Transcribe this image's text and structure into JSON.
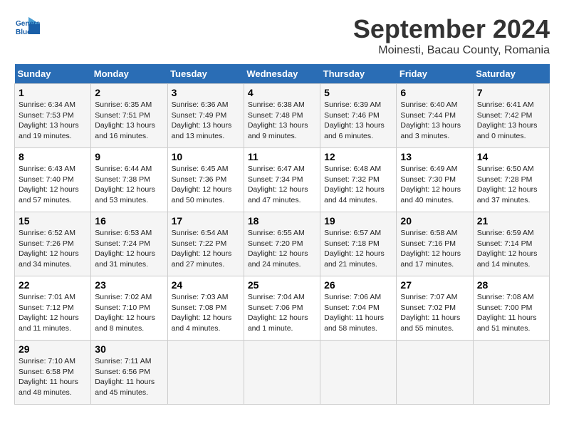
{
  "header": {
    "logo_line1": "General",
    "logo_line2": "Blue",
    "title": "September 2024",
    "subtitle": "Moinesti, Bacau County, Romania"
  },
  "days_of_week": [
    "Sunday",
    "Monday",
    "Tuesday",
    "Wednesday",
    "Thursday",
    "Friday",
    "Saturday"
  ],
  "weeks": [
    [
      {
        "day": "1",
        "sunrise": "Sunrise: 6:34 AM",
        "sunset": "Sunset: 7:53 PM",
        "daylight": "Daylight: 13 hours and 19 minutes."
      },
      {
        "day": "2",
        "sunrise": "Sunrise: 6:35 AM",
        "sunset": "Sunset: 7:51 PM",
        "daylight": "Daylight: 13 hours and 16 minutes."
      },
      {
        "day": "3",
        "sunrise": "Sunrise: 6:36 AM",
        "sunset": "Sunset: 7:49 PM",
        "daylight": "Daylight: 13 hours and 13 minutes."
      },
      {
        "day": "4",
        "sunrise": "Sunrise: 6:38 AM",
        "sunset": "Sunset: 7:48 PM",
        "daylight": "Daylight: 13 hours and 9 minutes."
      },
      {
        "day": "5",
        "sunrise": "Sunrise: 6:39 AM",
        "sunset": "Sunset: 7:46 PM",
        "daylight": "Daylight: 13 hours and 6 minutes."
      },
      {
        "day": "6",
        "sunrise": "Sunrise: 6:40 AM",
        "sunset": "Sunset: 7:44 PM",
        "daylight": "Daylight: 13 hours and 3 minutes."
      },
      {
        "day": "7",
        "sunrise": "Sunrise: 6:41 AM",
        "sunset": "Sunset: 7:42 PM",
        "daylight": "Daylight: 13 hours and 0 minutes."
      }
    ],
    [
      {
        "day": "8",
        "sunrise": "Sunrise: 6:43 AM",
        "sunset": "Sunset: 7:40 PM",
        "daylight": "Daylight: 12 hours and 57 minutes."
      },
      {
        "day": "9",
        "sunrise": "Sunrise: 6:44 AM",
        "sunset": "Sunset: 7:38 PM",
        "daylight": "Daylight: 12 hours and 53 minutes."
      },
      {
        "day": "10",
        "sunrise": "Sunrise: 6:45 AM",
        "sunset": "Sunset: 7:36 PM",
        "daylight": "Daylight: 12 hours and 50 minutes."
      },
      {
        "day": "11",
        "sunrise": "Sunrise: 6:47 AM",
        "sunset": "Sunset: 7:34 PM",
        "daylight": "Daylight: 12 hours and 47 minutes."
      },
      {
        "day": "12",
        "sunrise": "Sunrise: 6:48 AM",
        "sunset": "Sunset: 7:32 PM",
        "daylight": "Daylight: 12 hours and 44 minutes."
      },
      {
        "day": "13",
        "sunrise": "Sunrise: 6:49 AM",
        "sunset": "Sunset: 7:30 PM",
        "daylight": "Daylight: 12 hours and 40 minutes."
      },
      {
        "day": "14",
        "sunrise": "Sunrise: 6:50 AM",
        "sunset": "Sunset: 7:28 PM",
        "daylight": "Daylight: 12 hours and 37 minutes."
      }
    ],
    [
      {
        "day": "15",
        "sunrise": "Sunrise: 6:52 AM",
        "sunset": "Sunset: 7:26 PM",
        "daylight": "Daylight: 12 hours and 34 minutes."
      },
      {
        "day": "16",
        "sunrise": "Sunrise: 6:53 AM",
        "sunset": "Sunset: 7:24 PM",
        "daylight": "Daylight: 12 hours and 31 minutes."
      },
      {
        "day": "17",
        "sunrise": "Sunrise: 6:54 AM",
        "sunset": "Sunset: 7:22 PM",
        "daylight": "Daylight: 12 hours and 27 minutes."
      },
      {
        "day": "18",
        "sunrise": "Sunrise: 6:55 AM",
        "sunset": "Sunset: 7:20 PM",
        "daylight": "Daylight: 12 hours and 24 minutes."
      },
      {
        "day": "19",
        "sunrise": "Sunrise: 6:57 AM",
        "sunset": "Sunset: 7:18 PM",
        "daylight": "Daylight: 12 hours and 21 minutes."
      },
      {
        "day": "20",
        "sunrise": "Sunrise: 6:58 AM",
        "sunset": "Sunset: 7:16 PM",
        "daylight": "Daylight: 12 hours and 17 minutes."
      },
      {
        "day": "21",
        "sunrise": "Sunrise: 6:59 AM",
        "sunset": "Sunset: 7:14 PM",
        "daylight": "Daylight: 12 hours and 14 minutes."
      }
    ],
    [
      {
        "day": "22",
        "sunrise": "Sunrise: 7:01 AM",
        "sunset": "Sunset: 7:12 PM",
        "daylight": "Daylight: 12 hours and 11 minutes."
      },
      {
        "day": "23",
        "sunrise": "Sunrise: 7:02 AM",
        "sunset": "Sunset: 7:10 PM",
        "daylight": "Daylight: 12 hours and 8 minutes."
      },
      {
        "day": "24",
        "sunrise": "Sunrise: 7:03 AM",
        "sunset": "Sunset: 7:08 PM",
        "daylight": "Daylight: 12 hours and 4 minutes."
      },
      {
        "day": "25",
        "sunrise": "Sunrise: 7:04 AM",
        "sunset": "Sunset: 7:06 PM",
        "daylight": "Daylight: 12 hours and 1 minute."
      },
      {
        "day": "26",
        "sunrise": "Sunrise: 7:06 AM",
        "sunset": "Sunset: 7:04 PM",
        "daylight": "Daylight: 11 hours and 58 minutes."
      },
      {
        "day": "27",
        "sunrise": "Sunrise: 7:07 AM",
        "sunset": "Sunset: 7:02 PM",
        "daylight": "Daylight: 11 hours and 55 minutes."
      },
      {
        "day": "28",
        "sunrise": "Sunrise: 7:08 AM",
        "sunset": "Sunset: 7:00 PM",
        "daylight": "Daylight: 11 hours and 51 minutes."
      }
    ],
    [
      {
        "day": "29",
        "sunrise": "Sunrise: 7:10 AM",
        "sunset": "Sunset: 6:58 PM",
        "daylight": "Daylight: 11 hours and 48 minutes."
      },
      {
        "day": "30",
        "sunrise": "Sunrise: 7:11 AM",
        "sunset": "Sunset: 6:56 PM",
        "daylight": "Daylight: 11 hours and 45 minutes."
      },
      null,
      null,
      null,
      null,
      null
    ]
  ]
}
